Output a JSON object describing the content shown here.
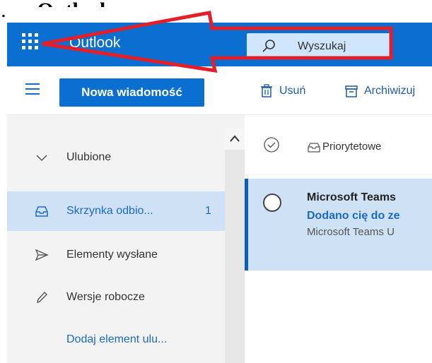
{
  "caption": {
    "prefix": "…y",
    "bold": "Outlook"
  },
  "header": {
    "app_title": "Outlook",
    "search_placeholder": "Wyszukaj",
    "brand_color": "#0b6fd1"
  },
  "toolbar": {
    "new_message": "Nowa wiadomość",
    "delete": "Usuń",
    "archive": "Archiwizuj"
  },
  "sidebar": {
    "items": [
      {
        "label": "Ulubione",
        "icon": "chevron-down-icon"
      },
      {
        "label": "Skrzynka odbio...",
        "icon": "inbox-icon",
        "count": "1",
        "selected": true
      },
      {
        "label": "Elementy wysłane",
        "icon": "send-icon"
      },
      {
        "label": "Wersje robocze",
        "icon": "pencil-icon"
      },
      {
        "label": "Dodaj element ulu...",
        "icon": "",
        "link": true
      }
    ]
  },
  "message_list": {
    "filter_label": "Priorytetowe",
    "messages": [
      {
        "sender": "Microsoft Teams",
        "subject": "Dodano cię do ze",
        "preview": "Microsoft Teams U"
      }
    ]
  },
  "annotation": {
    "arrow_color": "#e3202a"
  }
}
